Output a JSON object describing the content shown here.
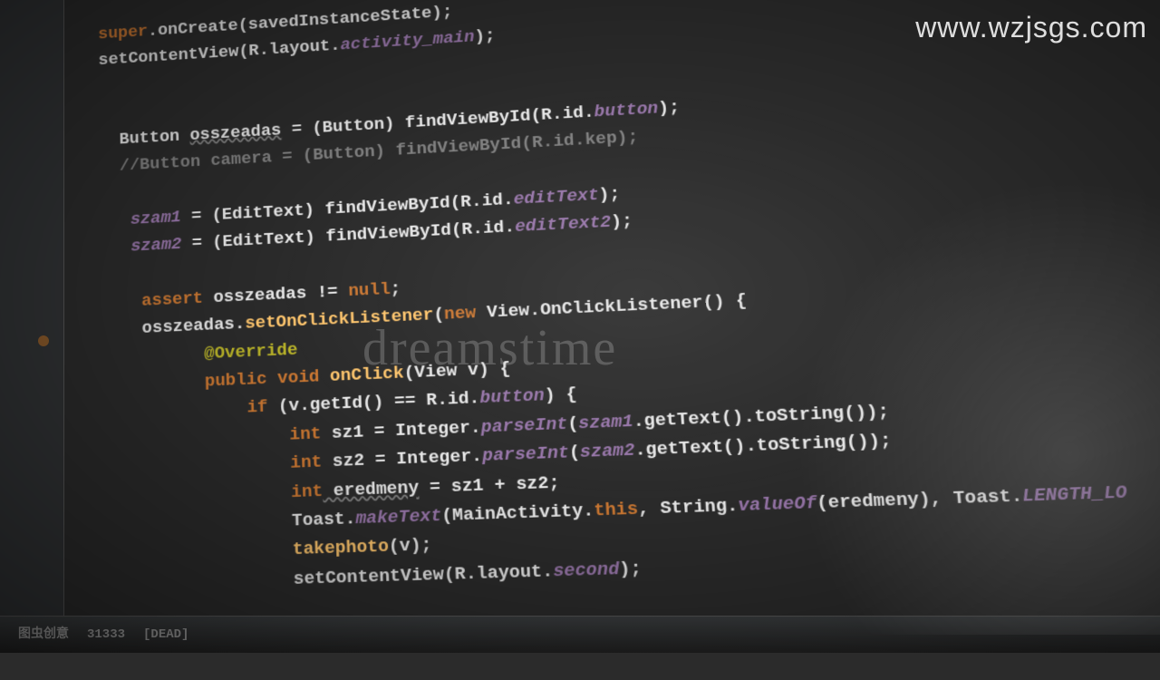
{
  "watermark": {
    "url": "www.wzjsgs.com",
    "center": "dreamstime"
  },
  "taskbar": {
    "item1": "图虫创意",
    "item2": "31333",
    "item3": "[DEAD]"
  },
  "code": {
    "l1a": "super",
    "l1b": ".onCreate(savedInstanceState);",
    "l2a": "setContentView",
    "l2b": "(R.layout.",
    "l2c": "activity_main",
    "l2d": ");",
    "l3a": "Button ",
    "l3b": "osszeadas",
    "l3c": " = (Button) ",
    "l3d": "findViewById",
    "l3e": "(R.id.",
    "l3f": "button",
    "l3g": ");",
    "l4": "//Button camera = (Button) findViewById(R.id.kep);",
    "l5a": "szam1",
    "l5b": " = (EditText) ",
    "l5c": "findViewById",
    "l5d": "(R.id.",
    "l5e": "editText",
    "l5f": ");",
    "l6a": "szam2",
    "l6b": " = (EditText) ",
    "l6c": "findViewById",
    "l6d": "(R.id.",
    "l6e": "editText2",
    "l6f": ");",
    "l7a": "assert",
    "l7b": " osszeadas != ",
    "l7c": "null",
    "l7d": ";",
    "l8a": "osszeadas.",
    "l8b": "setOnClickListener",
    "l8c": "(",
    "l8d": "new",
    "l8e": " View.OnClickListener() {",
    "l9": "@Override",
    "l10a": "public void",
    "l10b": " onClick",
    "l10c": "(View v) {",
    "l11a": "if",
    "l11b": " (v.getId() == R.id.",
    "l11c": "button",
    "l11d": ") {",
    "l12a": "int",
    "l12b": " sz1 = Integer.",
    "l12c": "parseInt",
    "l12d": "(",
    "l12e": "szam1",
    "l12f": ".getText().toString());",
    "l13a": "int",
    "l13b": " sz2 = Integer.",
    "l13c": "parseInt",
    "l13d": "(",
    "l13e": "szam2",
    "l13f": ".getText().toString());",
    "l14a": "int",
    "l14b": " eredmeny",
    "l14c": " = sz1 + sz2;",
    "l15a": "Toast.",
    "l15b": "makeText",
    "l15c": "(MainActivity.",
    "l15d": "this",
    "l15e": ", String.",
    "l15f": "valueOf",
    "l15g": "(eredmeny), Toast.",
    "l15h": "LENGTH_LO",
    "l16a": "takephoto",
    "l16b": "(v);",
    "l17a": "setContentView",
    "l17b": "(R.layout.",
    "l17c": "second",
    "l17d": ");"
  }
}
